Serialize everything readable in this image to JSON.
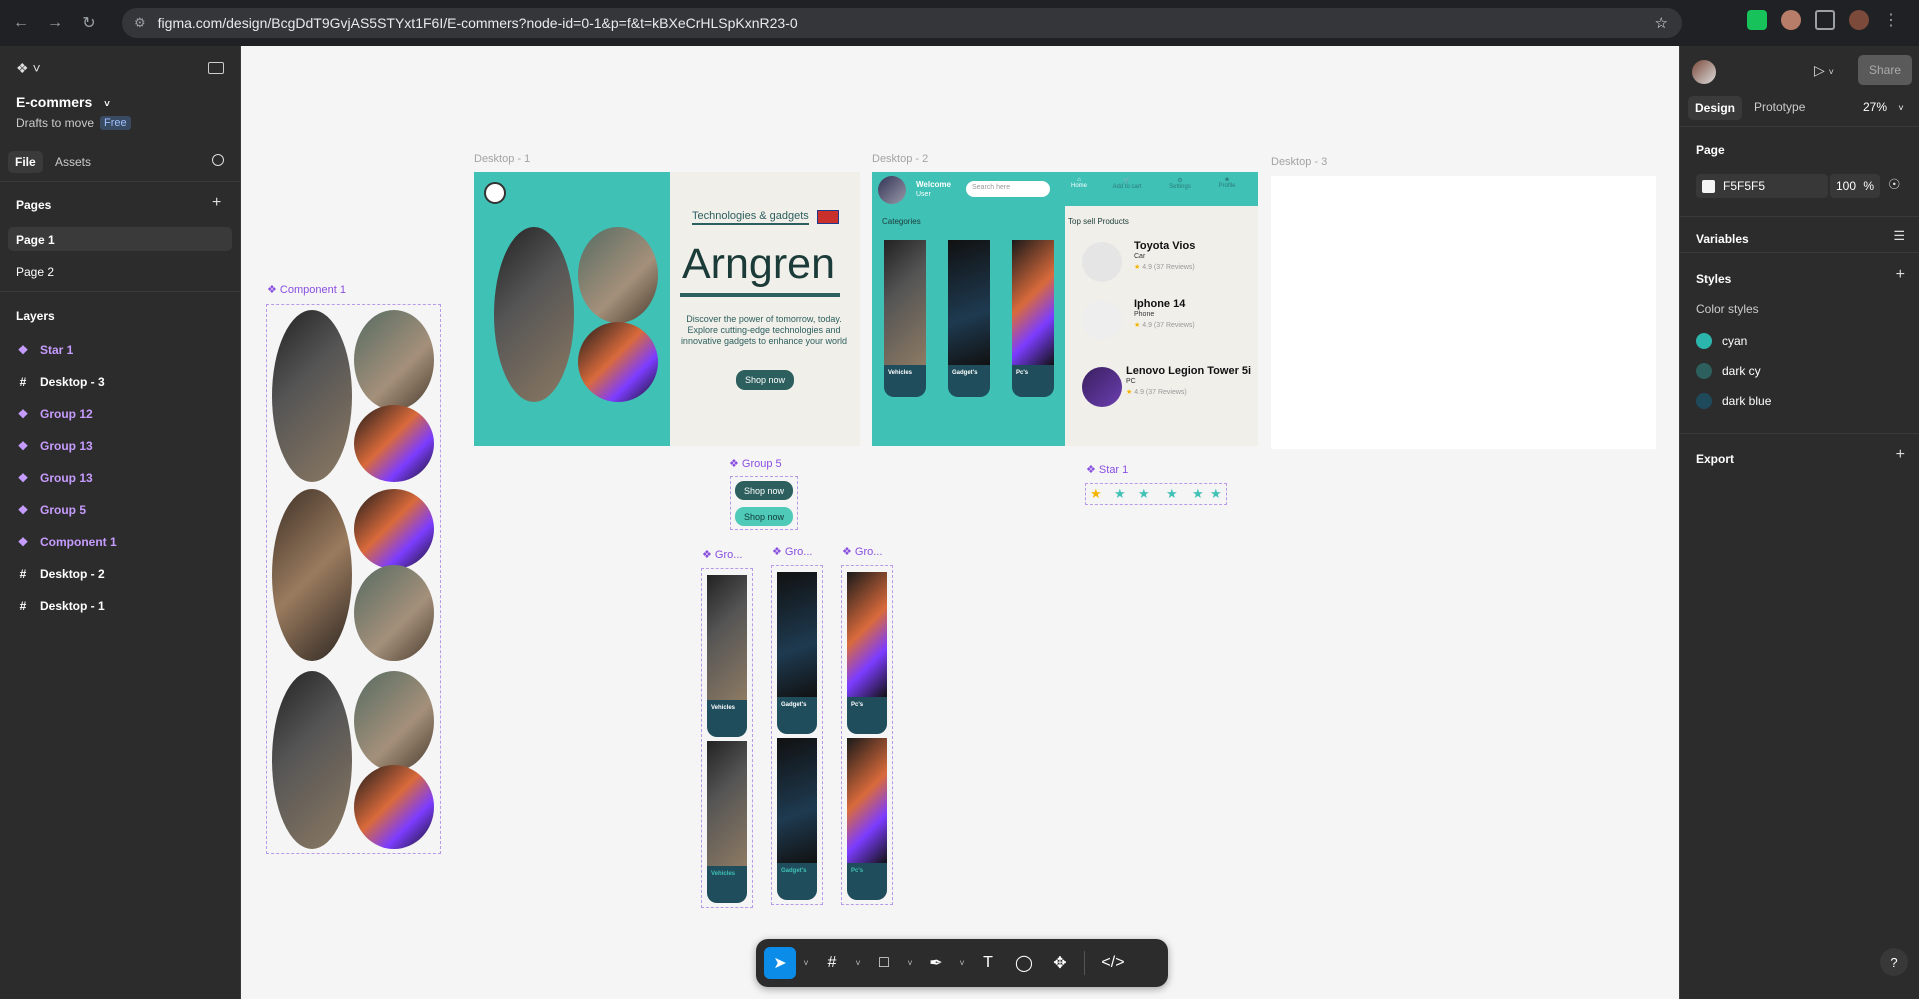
{
  "browser": {
    "url": "figma.com/design/BcgDdT9GvjAS5STYxt1F6I/E-commers?node-id=0-1&p=f&t=kBXeCrHLSpKxnR23-0"
  },
  "file": {
    "name": "E-commers",
    "location": "Drafts to move",
    "plan": "Free"
  },
  "left_tabs": [
    "File",
    "Assets"
  ],
  "pages": {
    "heading": "Pages",
    "items": [
      "Page 1",
      "Page 2"
    ]
  },
  "layers": {
    "heading": "Layers",
    "items": [
      {
        "name": "Star 1",
        "type": "component"
      },
      {
        "name": "Desktop - 3",
        "type": "frame"
      },
      {
        "name": "Group 12",
        "type": "component"
      },
      {
        "name": "Group 13",
        "type": "component"
      },
      {
        "name": "Group 13",
        "type": "component"
      },
      {
        "name": "Group 5",
        "type": "component"
      },
      {
        "name": "Component 1",
        "type": "component"
      },
      {
        "name": "Desktop - 2",
        "type": "frame"
      },
      {
        "name": "Desktop - 1",
        "type": "frame"
      }
    ]
  },
  "canvas": {
    "labels": {
      "component1": "Component 1",
      "desktop1": "Desktop - 1",
      "desktop2": "Desktop - 2",
      "desktop3": "Desktop - 3",
      "group5": "Group 5",
      "star1": "Star 1",
      "gro1": "Gro...",
      "gro2": "Gro...",
      "gro3": "Gro..."
    },
    "desktop1": {
      "tagline": "Technologies & gadgets",
      "title": "Arngren",
      "description": "Discover the power of tomorrow, today. Explore cutting-edge technologies and innovative gadgets to enhance your world",
      "cta": "Shop now"
    },
    "desktop2": {
      "welcome": "Welcome",
      "user": "User",
      "search_placeholder": "Search here",
      "nav": [
        "Home",
        "Add to cart",
        "Settings",
        "Profile"
      ],
      "categories_label": "Categories",
      "categories": [
        "Vehicles",
        "Gadget's",
        "Pc's"
      ],
      "top_label": "Top sell Products",
      "products": [
        {
          "name": "Toyota Vios",
          "type": "Car",
          "rating": "4.9 (37 Reviews)"
        },
        {
          "name": "Iphone 14",
          "type": "Phone",
          "rating": "4.9 (37 Reviews)"
        },
        {
          "name": "Lenovo Legion Tower 5i",
          "type": "PC",
          "rating": "4.9 (37 Reviews)"
        }
      ]
    },
    "group5": {
      "dark": "Shop now",
      "light": "Shop now"
    },
    "stars": {
      "filled": 1,
      "total": 6
    },
    "card_labels": [
      "Vehicles",
      "Gadget's",
      "Pc's"
    ]
  },
  "toolbar": {
    "tools": [
      "move-tool",
      "frame-tool",
      "shape-tool",
      "pen-tool",
      "text-tool",
      "comment-tool",
      "actions-tool",
      "dev-mode-toggle"
    ]
  },
  "right": {
    "tabs": [
      "Design",
      "Prototype"
    ],
    "zoom": "27%",
    "share": "Share",
    "page_heading": "Page",
    "page_color": "F5F5F5",
    "page_opacity": "100",
    "opacity_unit": "%",
    "variables": "Variables",
    "styles": "Styles",
    "color_styles_heading": "Color styles",
    "color_styles": [
      {
        "name": "cyan",
        "color": "#2cb5ad"
      },
      {
        "name": "dark cy",
        "color": "#2c5f5d"
      },
      {
        "name": "dark blue",
        "color": "#1f4a5c"
      }
    ],
    "export": "Export"
  },
  "colors": {
    "cyan": "#3fc1b6",
    "dark_teal": "#2c5f5d",
    "card_navy": "#1f4d5c",
    "accent_purple": "#8a4fe0",
    "selected_blue": "#0c8ce9"
  }
}
